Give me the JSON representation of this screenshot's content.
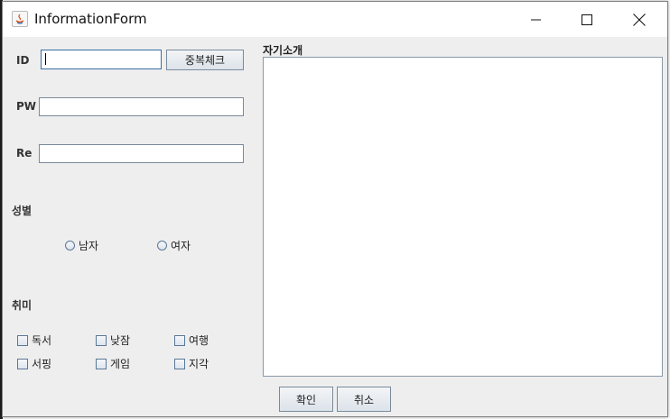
{
  "window": {
    "title": "InformationForm"
  },
  "form": {
    "id_label": "ID",
    "id_value": "",
    "duplicate_check_button": "중복체크",
    "pw_label": "PW",
    "pw_value": "",
    "re_label": "Re",
    "re_value": "",
    "gender_label": "성별",
    "gender_options": [
      "남자",
      "여자"
    ],
    "hobby_label": "취미",
    "hobby_options": [
      "독서",
      "낮잠",
      "여행",
      "서핑",
      "게임",
      "지각"
    ],
    "intro_label": "자기소개",
    "intro_value": "",
    "confirm_button": "확인",
    "cancel_button": "취소"
  }
}
